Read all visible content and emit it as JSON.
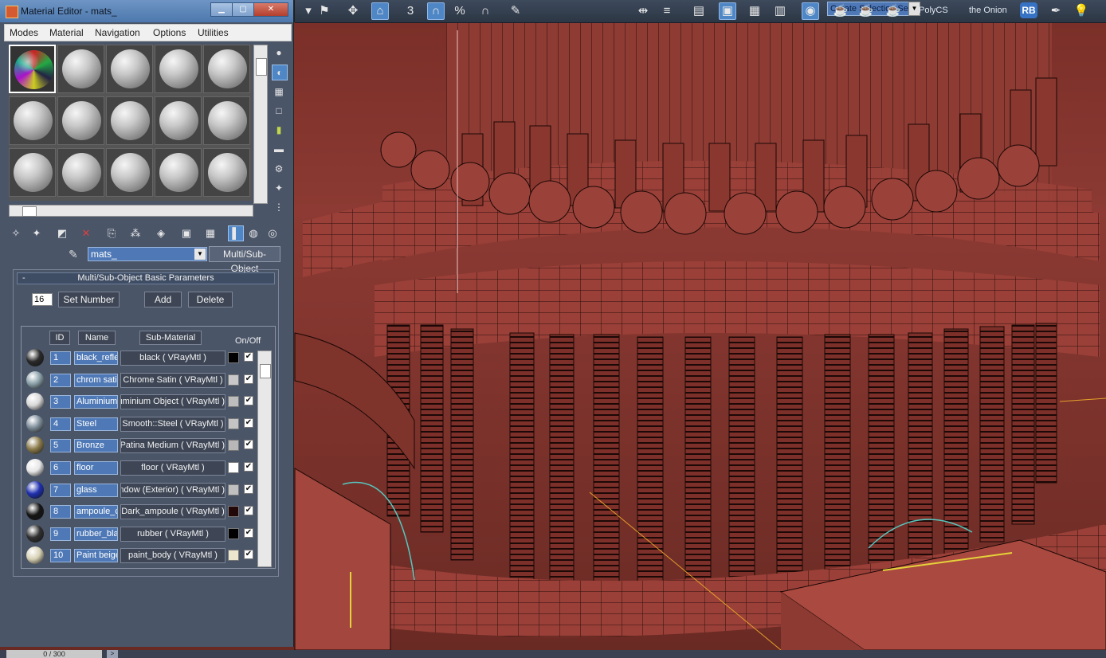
{
  "window": {
    "title": "Material Editor - mats_",
    "minimize_icon": "minimize-icon",
    "restore_icon": "restore-icon",
    "close_icon": "close-icon"
  },
  "menus": [
    "Modes",
    "Material",
    "Navigation",
    "Options",
    "Utilities"
  ],
  "toolbar": {
    "selection_set": "Create Selection Se",
    "labels": [
      "PolyCS",
      "the Onion"
    ],
    "rb_badge": "RB"
  },
  "editor": {
    "material_name": "mats_",
    "material_type": "Multi/Sub-Object"
  },
  "rollout": {
    "title": "Multi/Sub-Object Basic Parameters",
    "collapse": "-",
    "number_value": "16",
    "set_number": "Set Number",
    "add": "Add",
    "delete": "Delete"
  },
  "table": {
    "headers": {
      "id": "ID",
      "name": "Name",
      "sub_material": "Sub-Material",
      "on_off": "On/Off"
    },
    "check_mark": "✔",
    "rows": [
      {
        "id": "1",
        "name": "black_refle",
        "sub": "black  ( VRayMtl )",
        "swatch": "#000000",
        "preview": "#2a2a2a"
      },
      {
        "id": "2",
        "name": "chrom sati",
        "sub": "Chrome Satin  ( VRayMtl )",
        "swatch": "#c8c8c8",
        "preview": "#8aa0a8"
      },
      {
        "id": "3",
        "name": "Aluminium",
        "sub": "Aluminium Object  ( VRayMtl )",
        "swatch": "#bdbdbd",
        "preview": "#d8d8d8"
      },
      {
        "id": "4",
        "name": "Steel",
        "sub": "Smooth::Steel  ( VRayMtl )",
        "swatch": "#c4c4c4",
        "preview": "#7c8c98"
      },
      {
        "id": "5",
        "name": "Bronze",
        "sub": "Patina Medium  ( VRayMtl )",
        "swatch": "#b8b8b8",
        "preview": "#8b7a4a"
      },
      {
        "id": "6",
        "name": "floor",
        "sub": "floor  ( VRayMtl )",
        "swatch": "#ffffff",
        "preview": "#e6e6e6"
      },
      {
        "id": "7",
        "name": "glass",
        "sub": "Window (Exterior)  ( VRayMtl )",
        "swatch": "#c0c0c0",
        "preview": "#2030b0"
      },
      {
        "id": "8",
        "name": "ampoule_c",
        "sub": "Dark_ampoule  ( VRayMtl )",
        "swatch": "#220808",
        "preview": "#151515"
      },
      {
        "id": "9",
        "name": "rubber_bla",
        "sub": "rubber  ( VRayMtl )",
        "swatch": "#000000",
        "preview": "#303030"
      },
      {
        "id": "10",
        "name": "Paint beige",
        "sub": "paint_body  ( VRayMtl )",
        "swatch": "#ece6cf",
        "preview": "#d6d0b4"
      }
    ]
  },
  "status": {
    "frame_counter": "0 / 300",
    "next": ">"
  }
}
